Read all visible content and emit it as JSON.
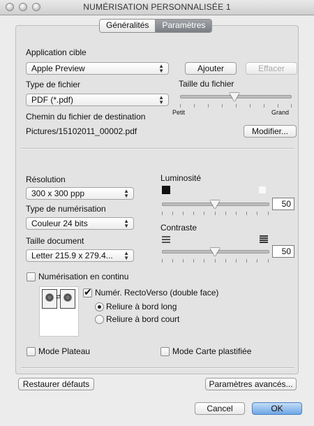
{
  "window": {
    "title": "NUMÉRISATION PERSONNALISÉE 1"
  },
  "tabs": [
    "Généralités",
    "Paramètres"
  ],
  "active_tab": "Paramètres",
  "app": {
    "label": "Application cible",
    "value": "Apple Preview",
    "add_button": "Ajouter",
    "delete_button": "Effacer"
  },
  "file": {
    "type_label": "Type de fichier",
    "type_value": "PDF (*.pdf)",
    "size_label": "Taille du fichier",
    "size_min": "Petit",
    "size_max": "Grand",
    "path_label": "Chemin du fichier de destination",
    "path_value": "Pictures/15102011_00002.pdf",
    "modify_button": "Modifier..."
  },
  "scan": {
    "resolution_label": "Résolution",
    "resolution_value": "300 x 300 ppp",
    "scan_type_label": "Type de numérisation",
    "scan_type_value": "Couleur 24 bits",
    "doc_size_label": "Taille document",
    "doc_size_value": "Letter 215.9 x 279.4...",
    "brightness_label": "Luminosité",
    "brightness_value": "50",
    "contrast_label": "Contraste",
    "contrast_value": "50"
  },
  "options": {
    "continuous_label": "Numérisation en continu",
    "continuous_checked": false,
    "duplex_label": "Numér. RectoVerso (double face)",
    "duplex_checked": true,
    "long_edge_label": "Reliure à bord long",
    "short_edge_label": "Reliure à bord court",
    "binding_selected": "long",
    "flatbed_label": "Mode Plateau",
    "flatbed_checked": false,
    "card_label": "Mode Carte plastifiée",
    "card_checked": false
  },
  "bottom": {
    "restore_button": "Restaurer défauts",
    "advanced_button": "Paramètres avancés...",
    "cancel_button": "Cancel",
    "ok_button": "OK"
  }
}
